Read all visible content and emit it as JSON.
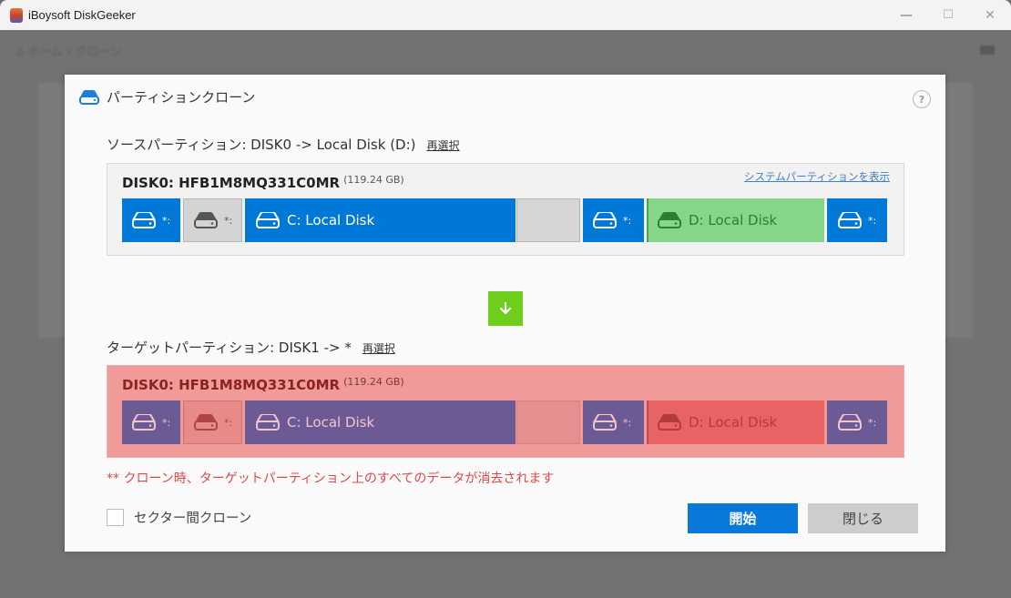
{
  "window": {
    "title": "iBoysoft DiskGeeker",
    "controls": {
      "minimize": "—",
      "maximize": "☐",
      "close": "✕"
    }
  },
  "background": {
    "breadcrumb": "⌂ ホーム › クローン"
  },
  "dialog": {
    "title": "パーティションクローン",
    "help_label": "?",
    "source": {
      "label": "ソースパーティション: DISK0 -> Local Disk (D:)",
      "reselect_label": "再選択",
      "disk_name": "DISK0: HFB1M8MQ331C0MR",
      "disk_size": "(119.24 GB)",
      "show_system_link": "システムパーティションを表示",
      "partitions": [
        {
          "type": "system",
          "label": "*:",
          "icon": "drive-icon"
        },
        {
          "type": "msr",
          "label": "*:",
          "icon": "drive-icon"
        },
        {
          "type": "primary",
          "label": "C: Local Disk",
          "icon": "drive-icon"
        },
        {
          "type": "unallocated",
          "label": ""
        },
        {
          "type": "system",
          "label": "*:",
          "icon": "drive-icon"
        },
        {
          "type": "selected",
          "label": "D: Local Disk",
          "icon": "drive-icon"
        },
        {
          "type": "system",
          "label": "*:",
          "icon": "drive-icon"
        }
      ]
    },
    "arrow_icon": "arrow-down-icon",
    "target": {
      "label": "ターゲットパーティション: DISK1 -> *",
      "reselect_label": "再選択",
      "disk_name": "DISK0: HFB1M8MQ331C0MR",
      "disk_size": "(119.24 GB)",
      "partitions": [
        {
          "type": "system",
          "label": "*:",
          "icon": "drive-icon"
        },
        {
          "type": "msr",
          "label": "*:",
          "icon": "drive-icon"
        },
        {
          "type": "primary",
          "label": "C: Local Disk",
          "icon": "drive-icon"
        },
        {
          "type": "unallocated",
          "label": ""
        },
        {
          "type": "system",
          "label": "*:",
          "icon": "drive-icon"
        },
        {
          "type": "selected",
          "label": "D: Local Disk",
          "icon": "drive-icon"
        },
        {
          "type": "system",
          "label": "*:",
          "icon": "drive-icon"
        }
      ]
    },
    "warning": "** クローン時、ターゲットパーティション上のすべてのデータが消去されます",
    "sector_clone": {
      "label": "セクター間クローン",
      "checked": false
    },
    "buttons": {
      "start": "開始",
      "close": "閉じる"
    }
  },
  "colors": {
    "accent_blue": "#0078d7",
    "arrow_green": "#6fce1c",
    "selected_green": "#86d68a",
    "target_bg": "#f09a9a",
    "target_partition": "#6b5a94",
    "warning_red": "#e04848"
  }
}
